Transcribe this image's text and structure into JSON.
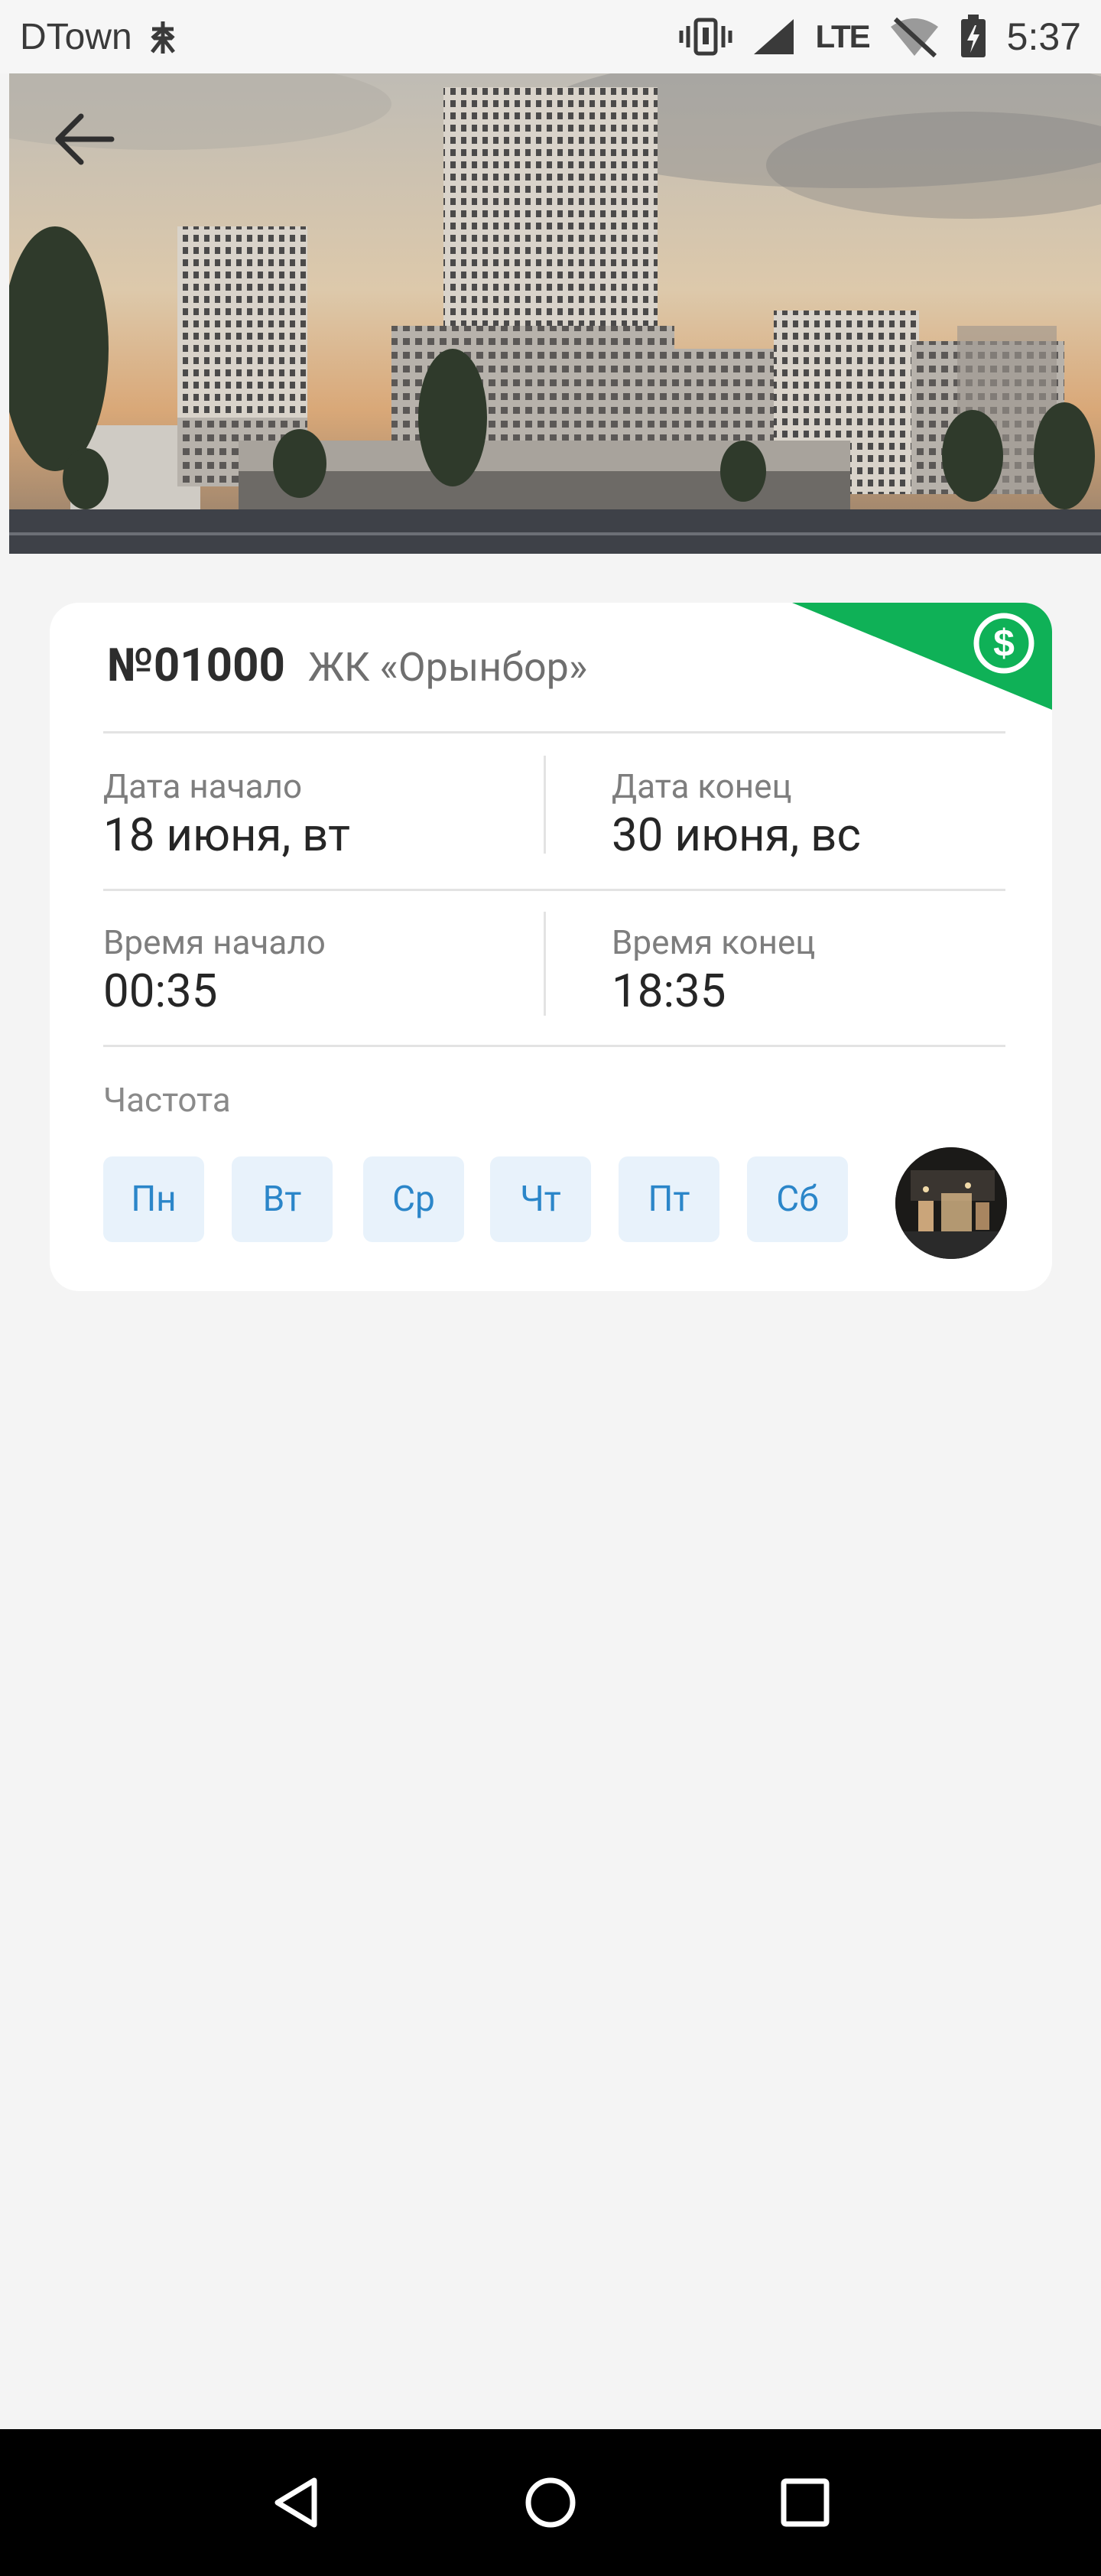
{
  "status_bar": {
    "carrier": "DTown",
    "network": "LTE",
    "time": "5:37"
  },
  "hero": {
    "back_icon": "arrow-left-icon"
  },
  "card": {
    "order_number": "№01000",
    "complex_name": "ЖК «Орынбор»",
    "paid_icon": "dollar-circle-icon",
    "accent_color": "#0fb157",
    "start_date_label": "Дата начало",
    "start_date_value": "18 июня, вт",
    "end_date_label": "Дата конец",
    "end_date_value": "30 июня, вс",
    "start_time_label": "Время начало",
    "start_time_value": "00:35",
    "end_time_label": "Время конец",
    "end_time_value": "18:35",
    "frequency_label": "Частота",
    "days": [
      "Пн",
      "Вт",
      "Ср",
      "Чт",
      "Пт",
      "Сб"
    ],
    "day_chip_color": "#2b86c9"
  },
  "nav_bar": {
    "back": "triangle-back-icon",
    "home": "circle-home-icon",
    "recents": "square-recents-icon"
  }
}
